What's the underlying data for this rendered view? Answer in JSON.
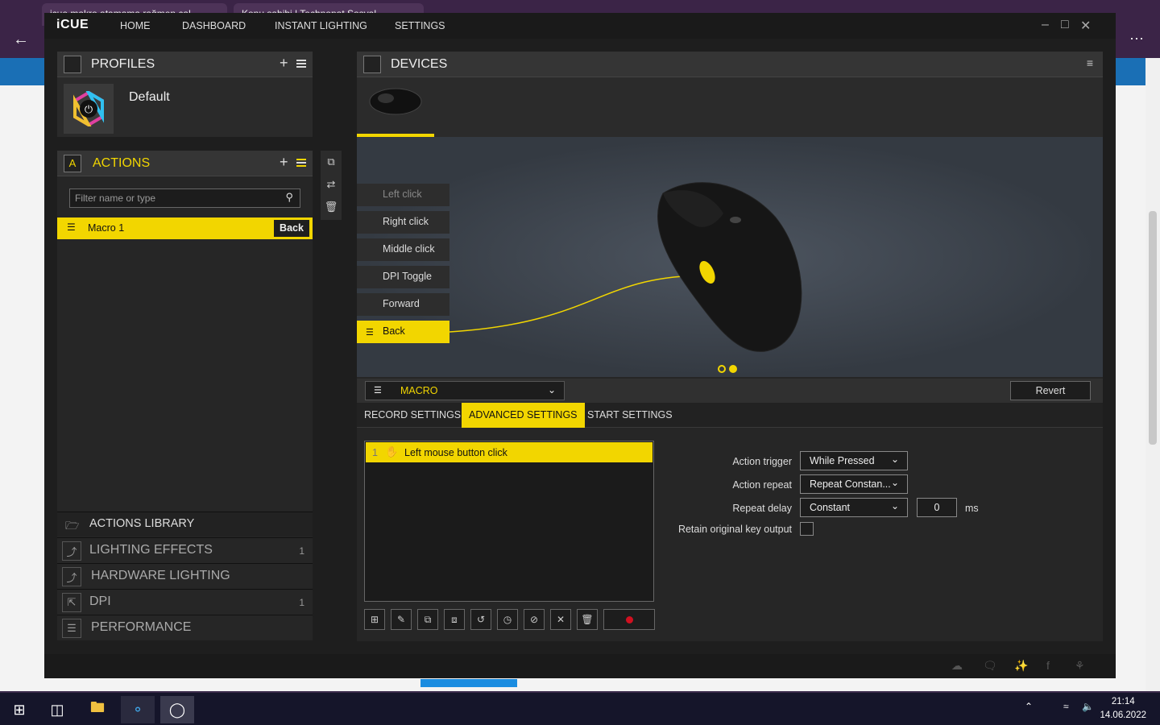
{
  "browser": {
    "tab1": "icue makro atamama rağmen çal",
    "tab2": "Konu sahibi | Technopat Sosyal"
  },
  "app": {
    "logo": "iCUE",
    "nav": [
      "HOME",
      "DASHBOARD",
      "INSTANT LIGHTING",
      "SETTINGS"
    ]
  },
  "profiles": {
    "title": "PROFILES",
    "default_name": "Default"
  },
  "actions": {
    "title": "ACTIONS",
    "filter_placeholder": "Filter name or type",
    "items": [
      {
        "name": "Macro 1",
        "key": "Back"
      }
    ]
  },
  "library": {
    "title": "ACTIONS LIBRARY",
    "items": [
      {
        "label": "LIGHTING EFFECTS",
        "count": "1"
      },
      {
        "label": "HARDWARE LIGHTING",
        "count": ""
      },
      {
        "label": "DPI",
        "count": "1"
      },
      {
        "label": "PERFORMANCE",
        "count": ""
      }
    ]
  },
  "devices": {
    "title": "DEVICES",
    "keys": [
      "Left click",
      "Right click",
      "Middle click",
      "DPI Toggle",
      "Forward",
      "Back"
    ],
    "active_key": "Back"
  },
  "macro": {
    "type": "MACRO",
    "revert": "Revert",
    "tabs": [
      "RECORD SETTINGS",
      "ADVANCED SETTINGS",
      "START SETTINGS"
    ],
    "steps": [
      {
        "index": "1",
        "label": "Left mouse button click"
      }
    ],
    "settings": {
      "trigger_label": "Action trigger",
      "trigger_value": "While Pressed",
      "repeat_label": "Action repeat",
      "repeat_value": "Repeat Constan...",
      "delay_label": "Repeat delay",
      "delay_value": "Constant",
      "delay_ms": "0",
      "delay_unit": "ms",
      "retain_label": "Retain original key output"
    }
  },
  "clock": {
    "time": "21:14",
    "date": "14.06.2022"
  },
  "colors": {
    "accent": "#f2d600",
    "panel": "#262626"
  }
}
